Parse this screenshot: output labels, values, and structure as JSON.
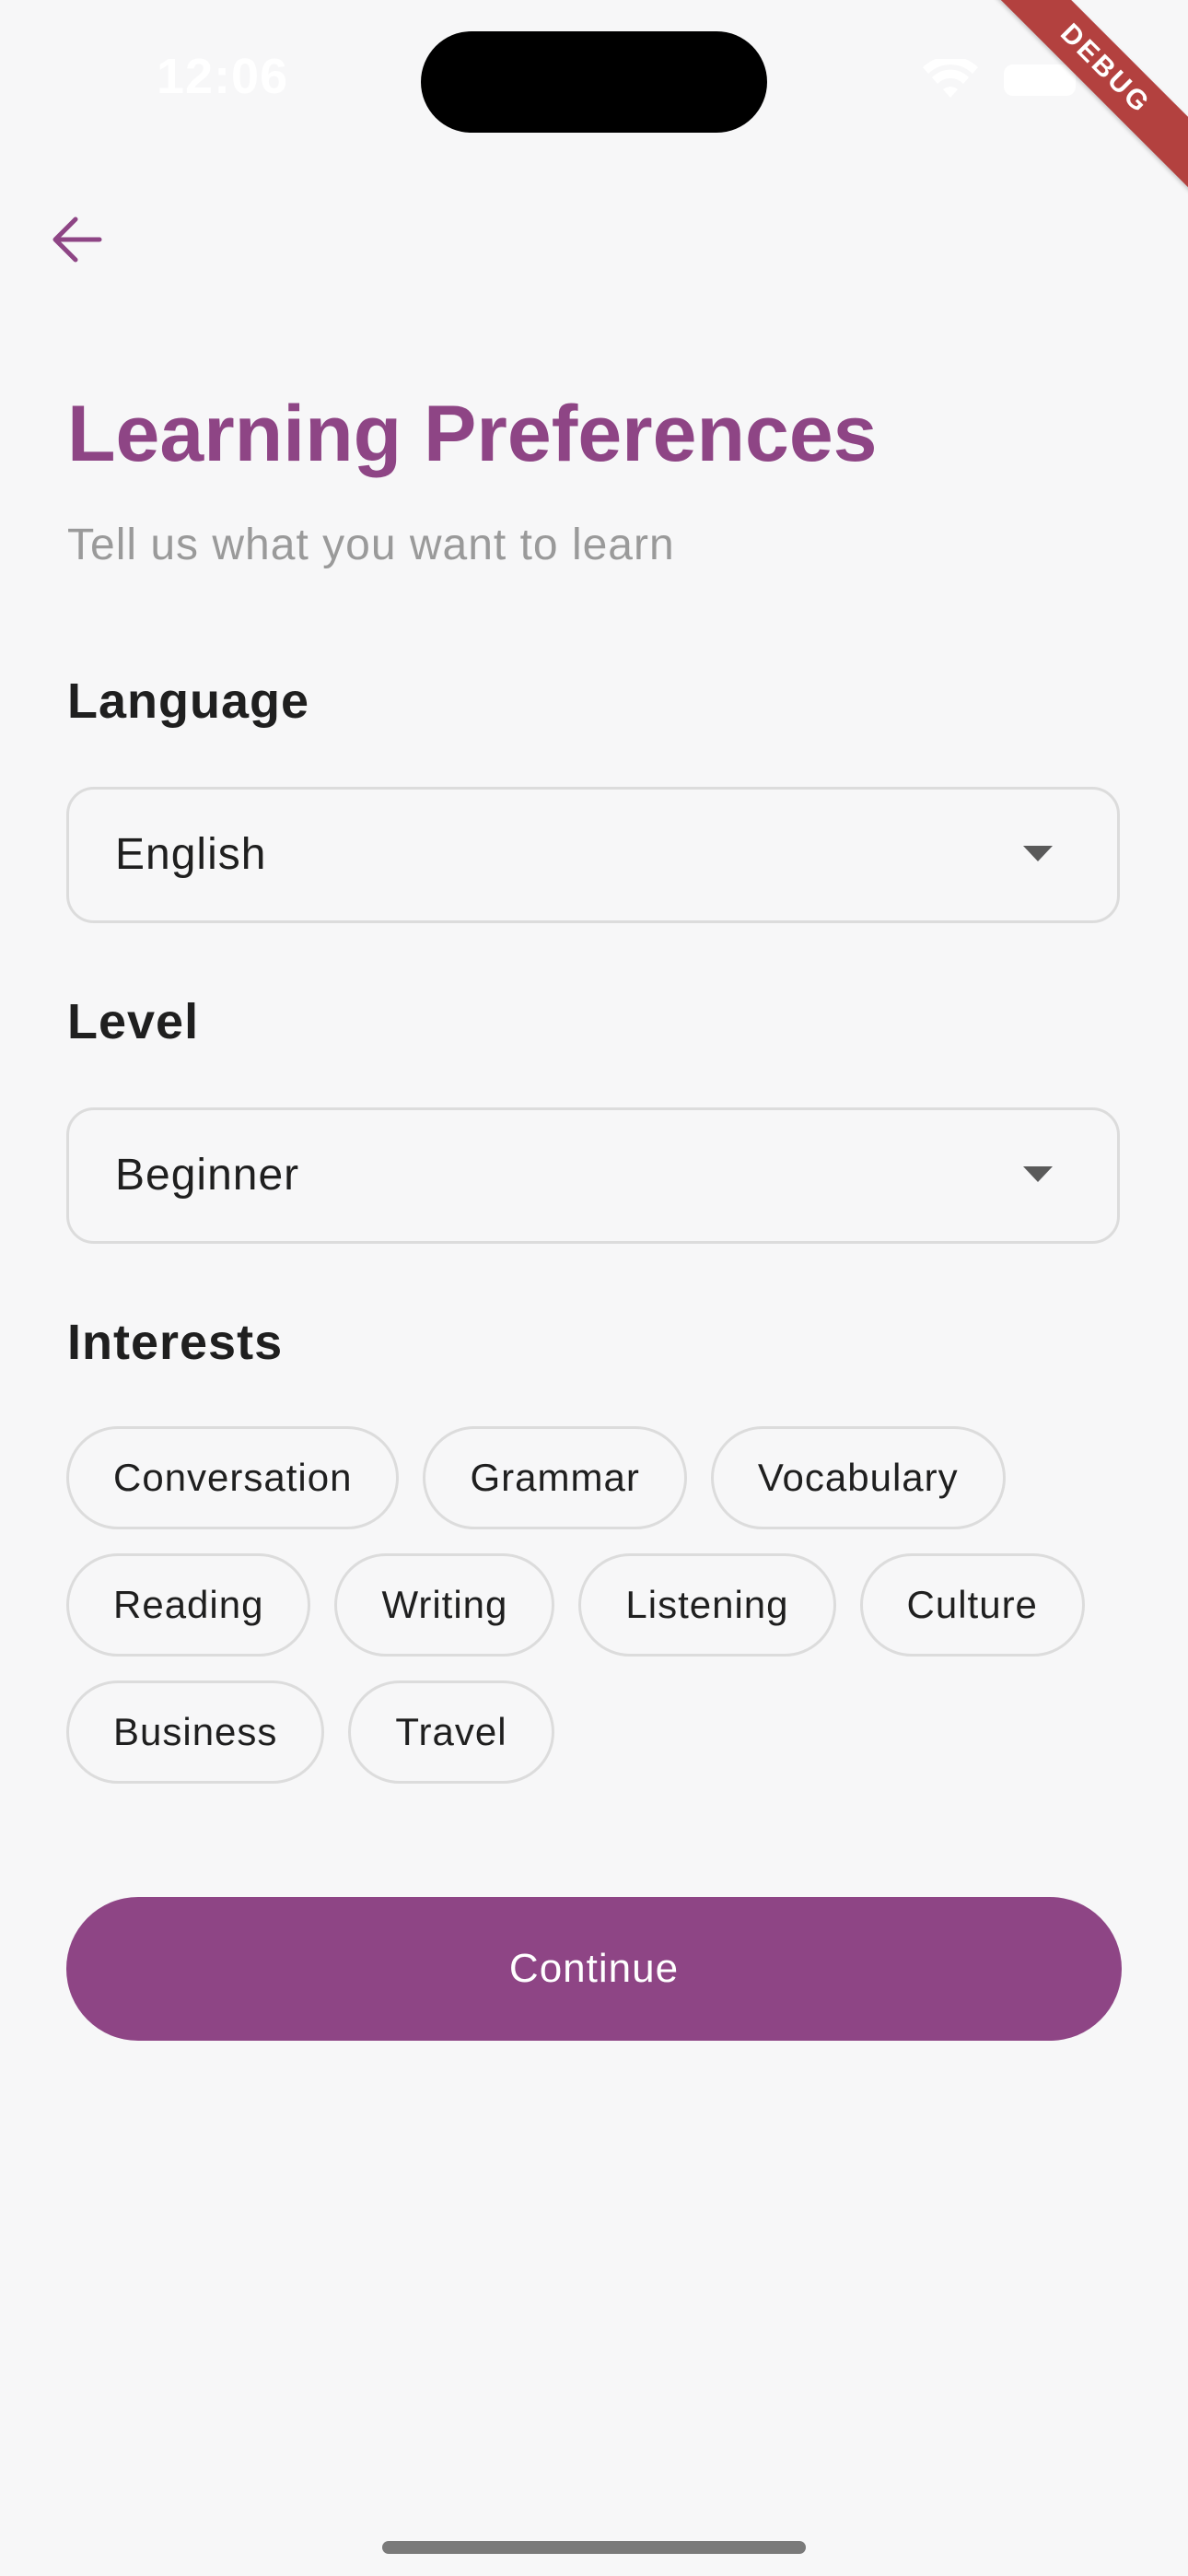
{
  "status_bar": {
    "time": "12:06",
    "wifi_icon": "wifi-icon",
    "battery_icon": "battery-icon"
  },
  "debug_banner": "DEBUG",
  "nav": {
    "back_icon": "arrow-left-icon"
  },
  "header": {
    "title": "Learning Preferences",
    "subtitle": "Tell us what you want to learn"
  },
  "language": {
    "label": "Language",
    "selected": "English"
  },
  "level": {
    "label": "Level",
    "selected": "Beginner"
  },
  "interests": {
    "label": "Interests",
    "chips": [
      "Conversation",
      "Grammar",
      "Vocabulary",
      "Reading",
      "Writing",
      "Listening",
      "Culture",
      "Business",
      "Travel"
    ]
  },
  "actions": {
    "continue_label": "Continue"
  },
  "colors": {
    "accent": "#8e4585",
    "background": "#f7f7f8",
    "border": "#dcdcdc",
    "debug_banner": "#b3413f"
  }
}
